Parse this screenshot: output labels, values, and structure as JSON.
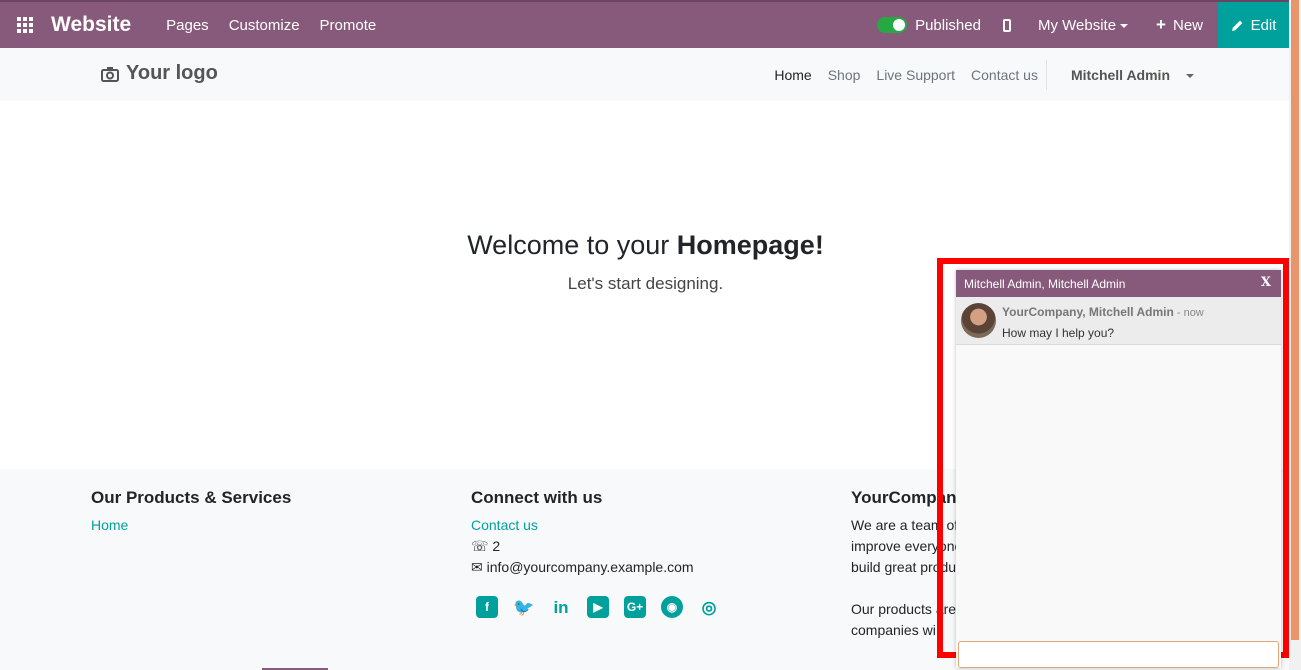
{
  "topbar": {
    "app_title": "Website",
    "menu": [
      "Pages",
      "Customize",
      "Promote"
    ],
    "published_label": "Published",
    "my_website_label": "My Website",
    "new_label": "New",
    "edit_label": "Edit",
    "published_on": true
  },
  "header": {
    "logo_text": "Your logo",
    "nav": [
      "Home",
      "Shop",
      "Live Support",
      "Contact us"
    ],
    "user_name": "Mitchell Admin"
  },
  "hero": {
    "title_prefix": "Welcome to your ",
    "title_bold": "Homepage!",
    "subtitle": "Let's start designing."
  },
  "footer": {
    "col1": {
      "heading": "Our Products & Services",
      "link": "Home"
    },
    "col2": {
      "heading": "Connect with us",
      "link": "Contact us",
      "phone": "2",
      "email": "info@yourcompany.example.com",
      "social_icons": [
        "facebook-icon",
        "twitter-icon",
        "linkedin-icon",
        "youtube-icon",
        "google-plus-icon",
        "github-icon",
        "instagram-icon"
      ]
    },
    "col3": {
      "heading": "YourCompan",
      "lines": [
        "We are a team of",
        "improve everyone",
        "build great produ",
        "",
        "Our products are",
        "companies wi"
      ]
    }
  },
  "chat": {
    "title": "Mitchell Admin, Mitchell Admin",
    "close_label": "X",
    "message_author": "YourCompany, Mitchell Admin",
    "message_time": " - now",
    "message_text": "How may I help you?",
    "input_value": ""
  },
  "colors": {
    "brand": "#875a7b",
    "accent": "#00a09d",
    "highlight": "#ff0000"
  }
}
